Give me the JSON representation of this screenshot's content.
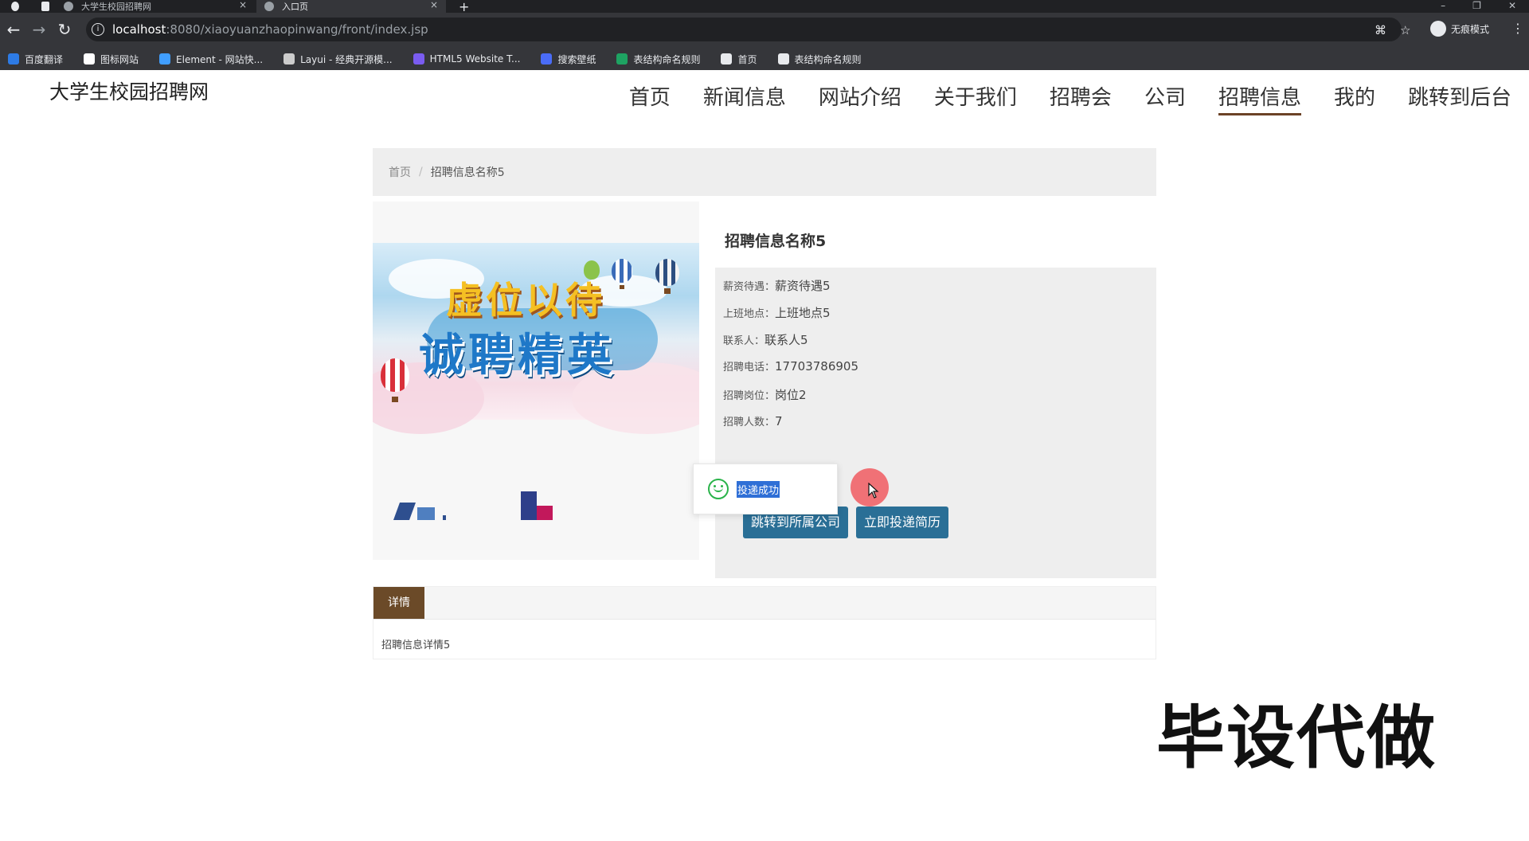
{
  "browser": {
    "tabs": [
      {
        "title": "大学生校园招聘网",
        "active": false
      },
      {
        "title": "入口页",
        "active": true
      }
    ],
    "new_tab_label": "+",
    "url_host": "localhost",
    "url_path": ":8080/xiaoyuanzhaopinwang/front/index.jsp",
    "incognito_label": "无痕模式",
    "bookmarks": [
      {
        "label": "百度翻译",
        "icon": "translate-icon",
        "color": "#2d7be5"
      },
      {
        "label": "图标网站",
        "icon": "flag-icon",
        "color": "#ffffff"
      },
      {
        "label": "Element - 网站快...",
        "icon": "hexagon-icon",
        "color": "#409eff"
      },
      {
        "label": "Layui - 经典开源模...",
        "icon": "layui-icon",
        "color": "#cccccc"
      },
      {
        "label": "HTML5 Website T...",
        "icon": "html5-icon",
        "color": "#7a5cf0"
      },
      {
        "label": "搜索壁纸",
        "icon": "wallpaper-icon",
        "color": "#4a6cf7"
      },
      {
        "label": "表结构命名规则",
        "icon": "sheet-icon",
        "color": "#1ea362"
      },
      {
        "label": "首页",
        "icon": "globe-icon",
        "color": "#e8eaed"
      },
      {
        "label": "表结构命名规则",
        "icon": "globe-icon",
        "color": "#e8eaed"
      }
    ]
  },
  "site": {
    "title": "大学生校园招聘网",
    "nav": [
      "首页",
      "新闻信息",
      "网站介绍",
      "关于我们",
      "招聘会",
      "公司",
      "招聘信息",
      "我的",
      "跳转到后台"
    ],
    "active_nav": "招聘信息",
    "accent_color": "#6b4226"
  },
  "breadcrumb": {
    "home": "首页",
    "separator": "/",
    "current": "招聘信息名称5"
  },
  "banner": {
    "line1": "虚位以待",
    "line2": "诚聘精英"
  },
  "job": {
    "title": "招聘信息名称5",
    "fields": [
      {
        "label": "薪资待遇：",
        "value": "薪资待遇5"
      },
      {
        "label": "上班地点：",
        "value": "上班地点5"
      },
      {
        "label": "联系人：",
        "value": "联系人5"
      },
      {
        "label": "招聘电话：",
        "value": "17703786905"
      },
      {
        "label": "招聘岗位：",
        "value": "岗位2"
      },
      {
        "label": "招聘人数：",
        "value": "7"
      }
    ],
    "buttons": {
      "company": "跳转到所属公司",
      "resume": "立即投递简历"
    },
    "button_color": "#2a6f96"
  },
  "toast": {
    "message": "投递成功"
  },
  "detail": {
    "tab_label": "详情",
    "content": "招聘信息详情5"
  },
  "watermark": "毕设代做"
}
